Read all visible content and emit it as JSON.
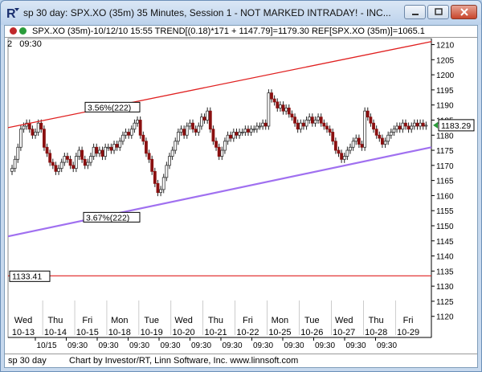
{
  "window": {
    "title": "sp 30 day: SPX.XO (35m) 35 Minutes, Session 1 - NOT MARKED INTRADAY! - INC...",
    "buttons": [
      "minimize",
      "maximize",
      "close"
    ]
  },
  "legend": {
    "text": "SPX.XO (35m)-10/12/10 15:55 TREND[(0.18)*171 + 1147.79]=1179.30 REF[SPX.XO (35m)]=1065.1",
    "dot1_color": "#c0282a",
    "dot2_color": "#2a9c3a"
  },
  "subheader": {
    "left": "2",
    "time": "09:30"
  },
  "footer": {
    "left": "sp 30 day",
    "credit": "Chart by Investor/RT, Linn Software, Inc. www.linnsoft.com"
  },
  "chart_data": {
    "type": "candlestick",
    "y_ticks": [
      "1210",
      "1205",
      "1200",
      "1195",
      "1190",
      "1185",
      "1180",
      "1175",
      "1170",
      "1165",
      "1160",
      "1155",
      "1150",
      "1145",
      "1140",
      "1135",
      "1130",
      "1125",
      "1120"
    ],
    "ylim": [
      1117,
      1212
    ],
    "last_price": "1183.29",
    "last_price_color": "#2a9c3a",
    "reference_line": {
      "label": "1133.41",
      "value": 1133.41,
      "color": "#e02020"
    },
    "upper_channel": {
      "label": "3.56%(222)",
      "color": "#e02020",
      "start": 1182.5,
      "end": 1211
    },
    "lower_channel": {
      "label": "3.67%(222)",
      "color": "#a070f0",
      "start": 1146.5,
      "end": 1176
    },
    "days": [
      {
        "dow": "Wed",
        "date": "10-13"
      },
      {
        "dow": "Thu",
        "date": "10-14"
      },
      {
        "dow": "Fri",
        "date": "10-15"
      },
      {
        "dow": "Mon",
        "date": "10-18"
      },
      {
        "dow": "Tue",
        "date": "10-19"
      },
      {
        "dow": "Wed",
        "date": "10-20"
      },
      {
        "dow": "Thu",
        "date": "10-21"
      },
      {
        "dow": "Fri",
        "date": "10-22"
      },
      {
        "dow": "Mon",
        "date": "10-25"
      },
      {
        "dow": "Tue",
        "date": "10-26"
      },
      {
        "dow": "Wed",
        "date": "10-27"
      },
      {
        "dow": "Thu",
        "date": "10-28"
      },
      {
        "dow": "Fri",
        "date": "10-29"
      }
    ],
    "bottom_labels": [
      "10/15",
      "09:30",
      "09:30",
      "09:30",
      "09:30",
      "09:30",
      "09:30",
      "09:30",
      "09:30",
      "09:30",
      "09:30",
      "09:30"
    ],
    "closes": [
      1169,
      1172,
      1176,
      1182,
      1183,
      1184,
      1182,
      1180,
      1181,
      1184,
      1182,
      1176,
      1174,
      1171,
      1170,
      1168,
      1169,
      1171,
      1173,
      1172,
      1170,
      1169,
      1173,
      1175,
      1172,
      1170,
      1171,
      1173,
      1176,
      1174,
      1175,
      1173,
      1176,
      1176,
      1175,
      1177,
      1176,
      1178,
      1180,
      1181,
      1180,
      1182,
      1184,
      1185,
      1180,
      1178,
      1174,
      1172,
      1168,
      1164,
      1161,
      1162,
      1166,
      1170,
      1173,
      1175,
      1178,
      1181,
      1182,
      1180,
      1183,
      1184,
      1182,
      1181,
      1183,
      1186,
      1185,
      1188,
      1182,
      1178,
      1176,
      1173,
      1175,
      1178,
      1180,
      1179,
      1181,
      1180,
      1181,
      1181,
      1182,
      1181,
      1182,
      1182,
      1183,
      1183,
      1184,
      1183,
      1194,
      1192,
      1191,
      1189,
      1190,
      1188,
      1189,
      1187,
      1186,
      1184,
      1182,
      1184,
      1183,
      1185,
      1186,
      1184,
      1185,
      1186,
      1184,
      1183,
      1182,
      1181,
      1178,
      1175,
      1174,
      1172,
      1173,
      1175,
      1176,
      1178,
      1179,
      1177,
      1176,
      1188,
      1186,
      1184,
      1182,
      1180,
      1179,
      1177,
      1178,
      1180,
      1181,
      1182,
      1183,
      1182,
      1184,
      1183,
      1182,
      1183,
      1184,
      1183,
      1184,
      1183,
      1183.29
    ]
  }
}
